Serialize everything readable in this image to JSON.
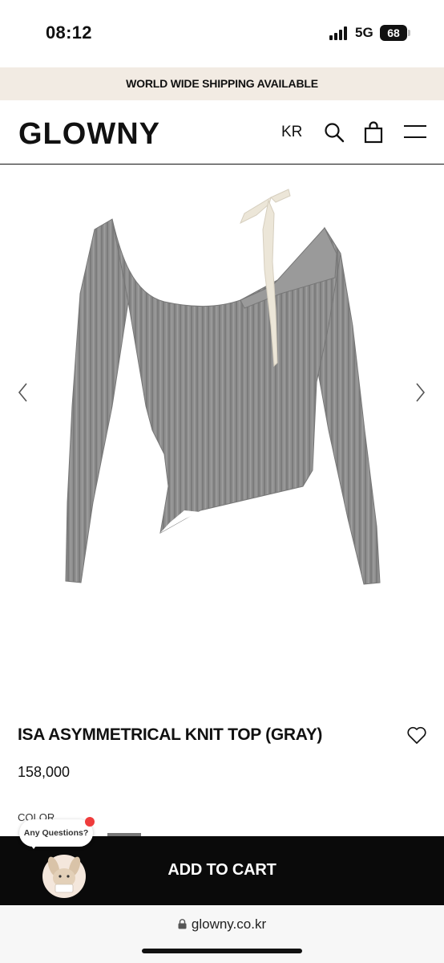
{
  "status_bar": {
    "time": "08:12",
    "network": "5G",
    "battery": "68"
  },
  "banner": {
    "text": "WORLD WIDE SHIPPING AVAILABLE"
  },
  "header": {
    "logo": "GLOWNY",
    "language": "KR",
    "icons": [
      "search-icon",
      "bag-icon",
      "menu-icon"
    ]
  },
  "gallery": {
    "image": "product-photo",
    "controls": [
      "prev-arrow-icon",
      "next-arrow-icon"
    ]
  },
  "product": {
    "title": "ISA ASYMMETRICAL KNIT TOP (GRAY)",
    "price": "158,000",
    "color_label": "COLOR",
    "wishlist_icon": "heart-icon"
  },
  "cart": {
    "label": "ADD TO CART"
  },
  "chat": {
    "bubble": "Any Questions?"
  },
  "browser": {
    "url": "glowny.co.kr"
  },
  "colors": {
    "banner_bg": "#f2ebe3",
    "cart_bg": "#0a0a0a",
    "knit_gray": "#8d8d8d",
    "ribbon": "#ece6d8"
  }
}
